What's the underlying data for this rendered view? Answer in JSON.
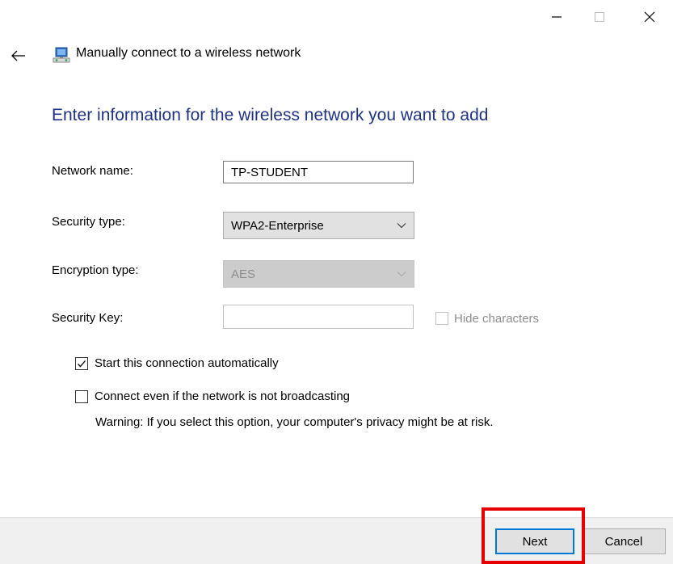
{
  "window": {
    "title": "Manually connect to a wireless network"
  },
  "heading": "Enter information for the wireless network you want to add",
  "form": {
    "network_name": {
      "label": "Network name:",
      "value": "TP-STUDENT"
    },
    "security_type": {
      "label": "Security type:",
      "value": "WPA2-Enterprise"
    },
    "encryption_type": {
      "label": "Encryption type:",
      "value": "AES"
    },
    "security_key": {
      "label": "Security Key:",
      "value": "",
      "hide_characters_label": "Hide characters",
      "hide_characters_checked": false
    }
  },
  "options": {
    "start_automatically": {
      "label": "Start this connection automatically",
      "checked": true
    },
    "connect_not_broadcasting": {
      "label": "Connect even if the network is not broadcasting",
      "checked": false
    },
    "warning": "Warning: If you select this option, your computer's privacy might be at risk."
  },
  "footer": {
    "next_label": "Next",
    "cancel_label": "Cancel"
  },
  "icons": {
    "back": "arrow-left-icon",
    "app": "network-icon",
    "minimize": "minimize-icon",
    "maximize": "maximize-icon",
    "close": "close-icon"
  },
  "colors": {
    "heading": "#1e3287",
    "focus_border": "#0078d7",
    "highlight": "#e60000",
    "footer_bg": "#f0f0f0"
  }
}
